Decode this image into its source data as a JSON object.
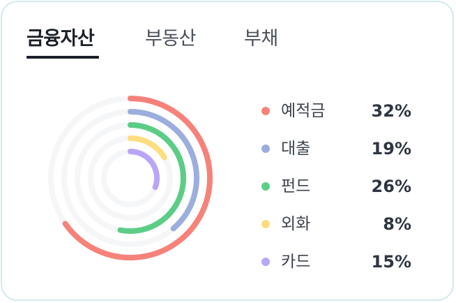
{
  "tabs": [
    {
      "label": "금융자산",
      "active": true
    },
    {
      "label": "부동산",
      "active": false
    },
    {
      "label": "부채",
      "active": false
    }
  ],
  "chart_data": {
    "type": "radial-bar",
    "items": [
      {
        "label": "예적금",
        "value": "32%",
        "percent": 32,
        "color": "#f6827a"
      },
      {
        "label": "대출",
        "value": "19%",
        "percent": 19,
        "color": "#9baedd"
      },
      {
        "label": "펀드",
        "value": "26%",
        "percent": 26,
        "color": "#5ccd86"
      },
      {
        "label": "외화",
        "value": "8%",
        "percent": 8,
        "color": "#fddd7f"
      },
      {
        "label": "카드",
        "value": "15%",
        "percent": 15,
        "color": "#b9a6f8"
      }
    ],
    "track_color": "#f5f6f8"
  }
}
